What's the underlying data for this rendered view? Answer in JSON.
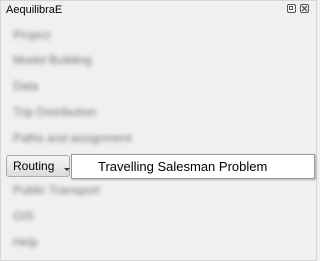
{
  "window": {
    "title": "AequilibraE"
  },
  "menu": {
    "items_before": [
      {
        "label": "Project"
      },
      {
        "label": "Model Building"
      },
      {
        "label": "Data"
      },
      {
        "label": "Trip Distribution"
      },
      {
        "label": "Paths and assignment"
      }
    ],
    "routing_label": "Routing",
    "items_after": [
      {
        "label": "Public Transport"
      },
      {
        "label": "GIS"
      },
      {
        "label": "Help"
      }
    ]
  },
  "dropdown": {
    "items": [
      {
        "label": "Travelling Salesman Problem"
      }
    ]
  }
}
